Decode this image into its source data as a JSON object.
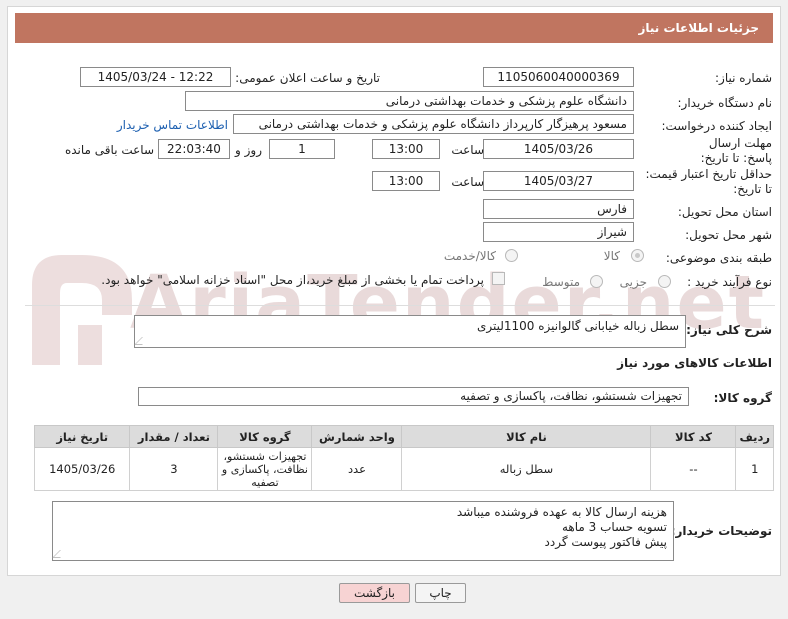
{
  "header": {
    "title": "جزئیات اطلاعات نیاز"
  },
  "fields": {
    "need_number_label": "شماره نیاز:",
    "need_number": "1105060040000369",
    "announce_label": "تاریخ و ساعت اعلان عمومی:",
    "announce_value": "1405/03/24 - 12:22",
    "buyer_org_label": "نام دستگاه خریدار:",
    "buyer_org": "دانشگاه علوم پزشکی و خدمات بهداشتی درمانی",
    "requester_label": "ایجاد کننده درخواست:",
    "requester": "مسعود پرهیزگار کارپرداز دانشگاه علوم پزشکی و خدمات بهداشتی درمانی",
    "contact_link": "اطلاعات تماس خریدار",
    "deadline_label": "مهلت ارسال پاسخ: تا تاریخ:",
    "deadline_date": "1405/03/26",
    "hour_label": "ساعت",
    "deadline_hour": "13:00",
    "days_value": "1",
    "day_and_label": "روز و",
    "remaining_time": "22:03:40",
    "remaining_label": "ساعت باقی مانده",
    "price_validity_label": "حداقل تاریخ اعتبار قیمت: تا تاریخ:",
    "price_validity_date": "1405/03/27",
    "price_validity_hour": "13:00",
    "province_label": "استان محل تحویل:",
    "province": "فارس",
    "city_label": "شهر محل تحویل:",
    "city": "شیراز",
    "category_label": "طبقه بندی موضوعی:",
    "category_goods": "کالا",
    "category_goods_service": "کالا/خدمت",
    "process_label": "نوع فرآیند خرید :",
    "process_minor": "جزیی",
    "process_medium": "متوسط",
    "payment_note": "پرداخت تمام یا بخشی از مبلغ خرید،از محل \"اسناد خزانه اسلامی\" خواهد بود."
  },
  "description": {
    "label": "شرح کلی نیاز:",
    "text": "سطل زباله خیابانی گالوانیزه 1100لیتری"
  },
  "goods_info": {
    "section_title": "اطلاعات کالاهای مورد نیاز",
    "group_label": "گروه کالا:",
    "group_value": "تجهیزات شستشو، نظافت، پاکسازی و تصفیه"
  },
  "table": {
    "headers": [
      "ردیف",
      "کد کالا",
      "نام کالا",
      "واحد شمارش",
      "گروه کالا",
      "تعداد / مقدار",
      "تاریخ نیاز"
    ],
    "rows": [
      [
        "1",
        "--",
        "سطل زباله",
        "عدد",
        "تجهیزات شستشو، نظافت، پاکسازی و تصفیه",
        "3",
        "1405/03/26"
      ]
    ]
  },
  "buyer_notes": {
    "label": "توضیحات خریدار:",
    "lines": [
      "هزینه ارسال کالا به عهده فروشنده میباشد",
      "تسویه حساب 3 ماهه",
      "پیش فاکتور پیوست گردد"
    ]
  },
  "buttons": {
    "print": "چاپ",
    "back": "بازگشت"
  },
  "watermark": {
    "text": "AriaTender.net"
  },
  "colors": {
    "title_bar": "#c07560",
    "back_button": "#f7d3d3",
    "link": "#1c5fb0"
  }
}
